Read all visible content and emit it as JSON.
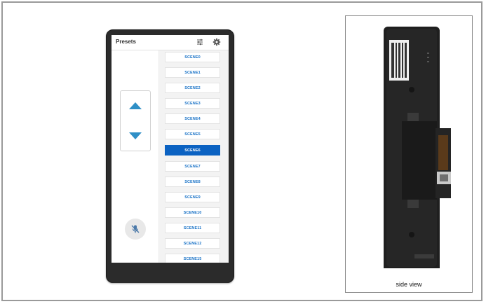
{
  "device": {
    "header": {
      "title": "Presets",
      "icons": [
        "sliders-icon",
        "gear-icon"
      ]
    },
    "arrows": {
      "up_icon": "triangle-up-icon",
      "down_icon": "triangle-down-icon"
    },
    "mute_icon": "microphone-off-icon",
    "scenes": [
      "SCENE0",
      "SCENE1",
      "SCENE2",
      "SCENE3",
      "SCENE4",
      "SCENE5",
      "SCENE6",
      "SCENE7",
      "SCENE8",
      "SCENE9",
      "SCENE10",
      "SCENE11",
      "SCENE12",
      "SCENE15"
    ],
    "active_scene": "SCENE6",
    "colors": {
      "accent": "#0b62c2",
      "arrow": "#2f8fc6",
      "scene_text": "#1a73c7"
    }
  },
  "side_view": {
    "caption": "side view"
  }
}
